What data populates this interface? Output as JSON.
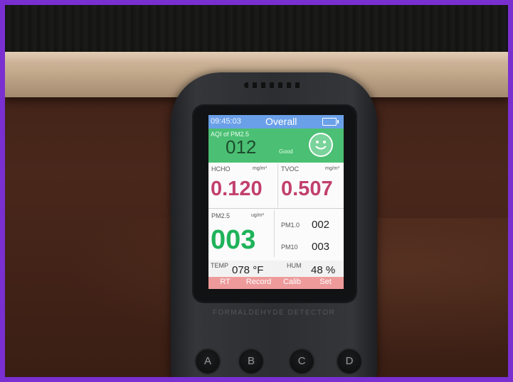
{
  "device": {
    "status_bar": {
      "time": "09:45:03",
      "mode": "Overall"
    },
    "aqi": {
      "label": "AQI of PM2.5",
      "value": "012",
      "status": "Good"
    },
    "hcho": {
      "label": "HCHO",
      "unit": "mg/m³",
      "value": "0.120"
    },
    "tvoc": {
      "label": "TVOC",
      "unit": "mg/m³",
      "value": "0.507"
    },
    "pm25": {
      "label": "PM2.5",
      "unit": "ug/m³",
      "value": "003"
    },
    "pm10_small": {
      "label": "PM1.0",
      "value": "002"
    },
    "pm10": {
      "label": "PM10",
      "value": "003"
    },
    "temp": {
      "label": "TEMP",
      "value": "078 °F"
    },
    "hum": {
      "label": "HUM",
      "value": "48 %"
    },
    "softkeys": [
      "RT",
      "Record",
      "Calib",
      "Set"
    ],
    "brand": "FORMALDEHYDE DETECTOR",
    "buttons": [
      "A",
      "B",
      "C",
      "D"
    ]
  },
  "colors": {
    "header": "#6aa0e8",
    "aqi_band": "#4bbf73",
    "gas_values": "#c2406e",
    "pm25_value": "#1fb35a",
    "softkey_bar": "#ee9a9a"
  },
  "icons": {
    "battery": "battery-icon",
    "smiley": "smiley-face-icon"
  }
}
